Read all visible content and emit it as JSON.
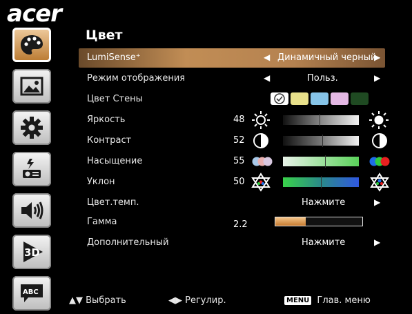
{
  "brand": "acer",
  "sidebar": {
    "items": [
      {
        "icon": "palette-icon",
        "active": true
      },
      {
        "icon": "image-icon",
        "active": false
      },
      {
        "icon": "gear-icon",
        "active": false
      },
      {
        "icon": "projector-icon",
        "active": false
      },
      {
        "icon": "speaker-icon",
        "active": false
      },
      {
        "icon": "3d-icon",
        "label": "3D",
        "active": false
      },
      {
        "icon": "abc-icon",
        "label": "ABC",
        "active": false
      }
    ]
  },
  "menu": {
    "title": "Цвет",
    "rows": [
      {
        "label": "LumiSense⁺",
        "value": "Динамичный черный"
      },
      {
        "label": "Режим отображения",
        "value": "Польз."
      },
      {
        "label": "Цвет Стены",
        "swatches": [
          "#ffffff",
          "#e8e08a",
          "#86c4e8",
          "#e4b8e4",
          "#1f4a22"
        ]
      },
      {
        "label": "Яркость",
        "value": "48",
        "level": 0.48
      },
      {
        "label": "Контраст",
        "value": "52",
        "level": 0.52
      },
      {
        "label": "Насыщение",
        "value": "55",
        "level": 0.55
      },
      {
        "label": "Уклон",
        "value": "50",
        "level": 0.5
      },
      {
        "label": "Цвет.темп.",
        "value": "Нажмите"
      },
      {
        "label": "Гамма",
        "value": "2.2",
        "level": 0.35
      },
      {
        "label": "Дополнительный",
        "value": "Нажмите"
      }
    ]
  },
  "footer": {
    "select": "Выбрать",
    "adjust": "Регулир.",
    "menu_key": "MENU",
    "main_menu": "Глав. меню"
  },
  "colors": {
    "highlight": "#b8864e",
    "accent": "#c57a30"
  }
}
